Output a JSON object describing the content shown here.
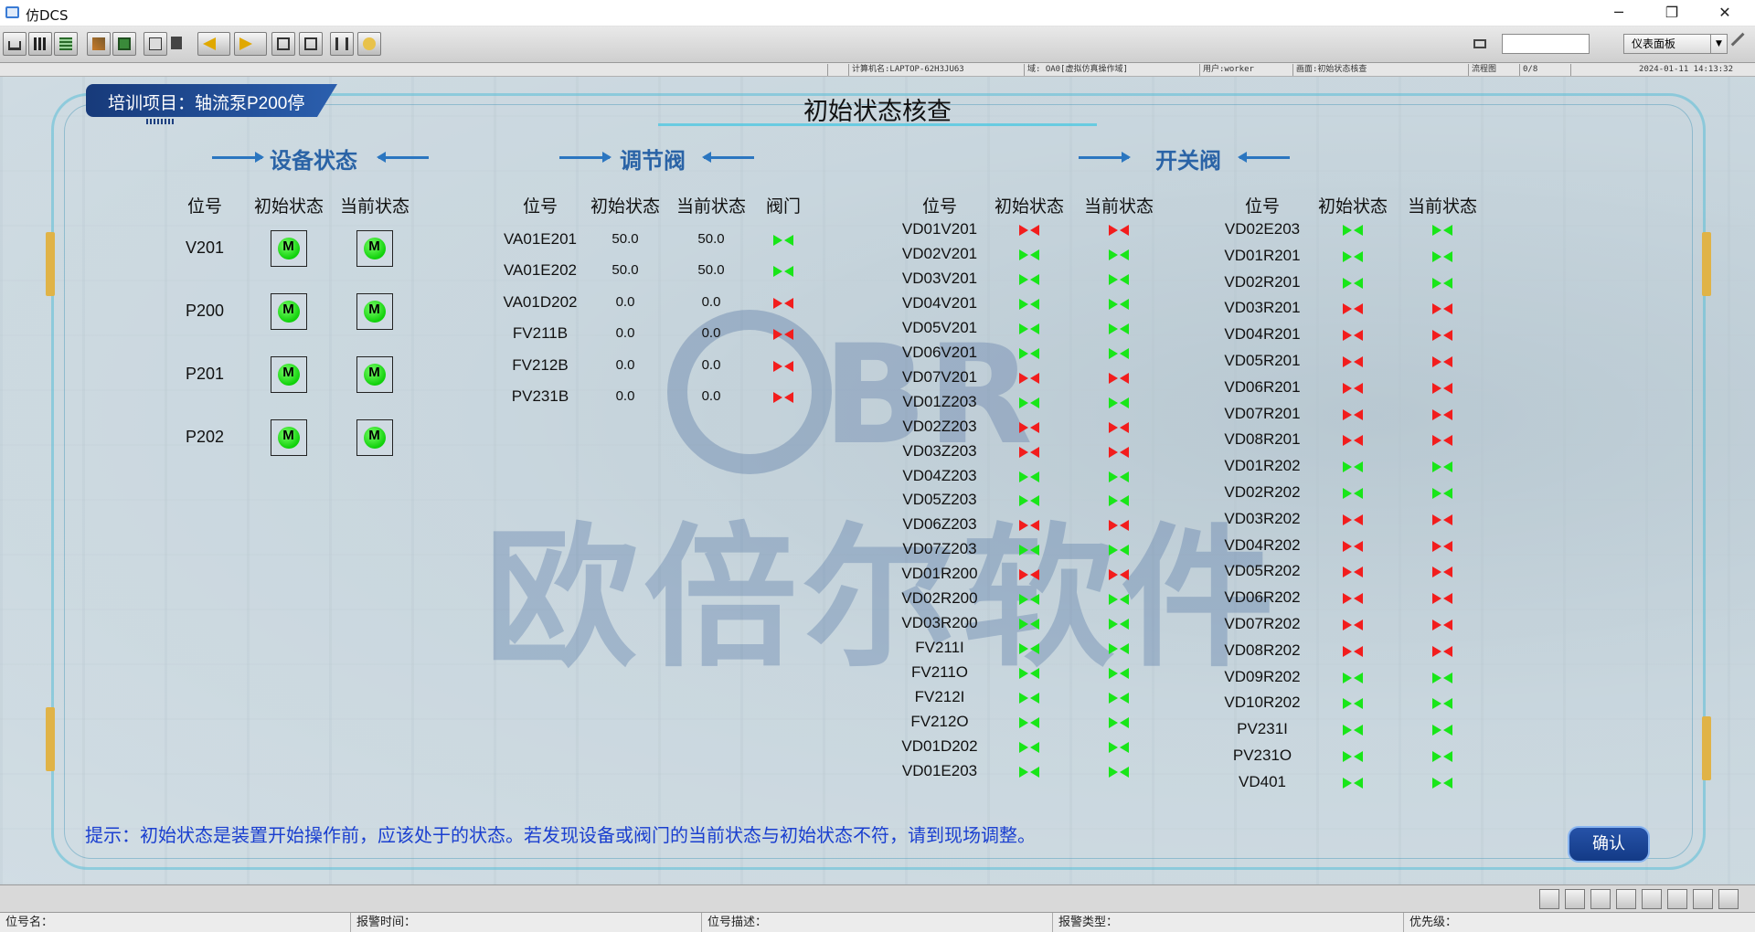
{
  "window": {
    "title": "仿DCS",
    "minimize": "─",
    "maximize": "❐",
    "close": "✕"
  },
  "toolbar": {
    "panel_select": "仪表面板",
    "search_value": ""
  },
  "infobar": {
    "computer": "计算机名:LAPTOP-62H3JU63",
    "domain": "域: OA0[虚拟仿真操作域]",
    "user": "用户:worker",
    "screen": "画面:初始状态核查",
    "mode": "流程图",
    "page": "0/8",
    "datetime": "2024-01-11 14:13:32"
  },
  "header": {
    "project": "培训项目：轴流泵P200停",
    "title": "初始状态核查"
  },
  "watermark": {
    "brand": "BR",
    "company": "欧倍尔软件"
  },
  "equipment": {
    "title": "设备状态",
    "headers": [
      "位号",
      "初始状态",
      "当前状态"
    ],
    "rows": [
      {
        "tag": "V201",
        "initial": "M",
        "current": "M"
      },
      {
        "tag": "P200",
        "initial": "M",
        "current": "M"
      },
      {
        "tag": "P201",
        "initial": "M",
        "current": "M"
      },
      {
        "tag": "P202",
        "initial": "M",
        "current": "M"
      }
    ]
  },
  "control_valves": {
    "title": "调节阀",
    "headers": [
      "位号",
      "初始状态",
      "当前状态",
      "阀门"
    ],
    "rows": [
      {
        "tag": "VA01E201",
        "initial": "50.0",
        "current": "50.0",
        "valve": "open"
      },
      {
        "tag": "VA01E202",
        "initial": "50.0",
        "current": "50.0",
        "valve": "open"
      },
      {
        "tag": "VA01D202",
        "initial": "0.0",
        "current": "0.0",
        "valve": "closed"
      },
      {
        "tag": "FV211B",
        "initial": "0.0",
        "current": "0.0",
        "valve": "closed"
      },
      {
        "tag": "FV212B",
        "initial": "0.0",
        "current": "0.0",
        "valve": "closed"
      },
      {
        "tag": "PV231B",
        "initial": "0.0",
        "current": "0.0",
        "valve": "closed"
      }
    ]
  },
  "switch_valves": {
    "title": "开关阀",
    "headers": [
      "位号",
      "初始状态",
      "当前状态"
    ],
    "left": [
      {
        "tag": "VD01V201",
        "initial": "closed",
        "current": "closed"
      },
      {
        "tag": "VD02V201",
        "initial": "open",
        "current": "open"
      },
      {
        "tag": "VD03V201",
        "initial": "open",
        "current": "open"
      },
      {
        "tag": "VD04V201",
        "initial": "open",
        "current": "open"
      },
      {
        "tag": "VD05V201",
        "initial": "open",
        "current": "open"
      },
      {
        "tag": "VD06V201",
        "initial": "open",
        "current": "open"
      },
      {
        "tag": "VD07V201",
        "initial": "closed",
        "current": "closed"
      },
      {
        "tag": "VD01Z203",
        "initial": "open",
        "current": "open"
      },
      {
        "tag": "VD02Z203",
        "initial": "closed",
        "current": "closed"
      },
      {
        "tag": "VD03Z203",
        "initial": "closed",
        "current": "closed"
      },
      {
        "tag": "VD04Z203",
        "initial": "open",
        "current": "open"
      },
      {
        "tag": "VD05Z203",
        "initial": "open",
        "current": "open"
      },
      {
        "tag": "VD06Z203",
        "initial": "closed",
        "current": "closed"
      },
      {
        "tag": "VD07Z203",
        "initial": "open",
        "current": "open"
      },
      {
        "tag": "VD01R200",
        "initial": "closed",
        "current": "closed"
      },
      {
        "tag": "VD02R200",
        "initial": "open",
        "current": "open"
      },
      {
        "tag": "VD03R200",
        "initial": "open",
        "current": "open"
      },
      {
        "tag": "FV211I",
        "initial": "open",
        "current": "open"
      },
      {
        "tag": "FV211O",
        "initial": "open",
        "current": "open"
      },
      {
        "tag": "FV212I",
        "initial": "open",
        "current": "open"
      },
      {
        "tag": "FV212O",
        "initial": "open",
        "current": "open"
      },
      {
        "tag": "VD01D202",
        "initial": "open",
        "current": "open"
      },
      {
        "tag": "VD01E203",
        "initial": "open",
        "current": "open"
      }
    ],
    "right": [
      {
        "tag": "VD02E203",
        "initial": "open",
        "current": "open"
      },
      {
        "tag": "VD01R201",
        "initial": "open",
        "current": "open"
      },
      {
        "tag": "VD02R201",
        "initial": "open",
        "current": "open"
      },
      {
        "tag": "VD03R201",
        "initial": "closed",
        "current": "closed"
      },
      {
        "tag": "VD04R201",
        "initial": "closed",
        "current": "closed"
      },
      {
        "tag": "VD05R201",
        "initial": "closed",
        "current": "closed"
      },
      {
        "tag": "VD06R201",
        "initial": "closed",
        "current": "closed"
      },
      {
        "tag": "VD07R201",
        "initial": "closed",
        "current": "closed"
      },
      {
        "tag": "VD08R201",
        "initial": "closed",
        "current": "closed"
      },
      {
        "tag": "VD01R202",
        "initial": "open",
        "current": "open"
      },
      {
        "tag": "VD02R202",
        "initial": "open",
        "current": "open"
      },
      {
        "tag": "VD03R202",
        "initial": "closed",
        "current": "closed"
      },
      {
        "tag": "VD04R202",
        "initial": "closed",
        "current": "closed"
      },
      {
        "tag": "VD05R202",
        "initial": "closed",
        "current": "closed"
      },
      {
        "tag": "VD06R202",
        "initial": "closed",
        "current": "closed"
      },
      {
        "tag": "VD07R202",
        "initial": "closed",
        "current": "closed"
      },
      {
        "tag": "VD08R202",
        "initial": "closed",
        "current": "closed"
      },
      {
        "tag": "VD09R202",
        "initial": "open",
        "current": "open"
      },
      {
        "tag": "VD10R202",
        "initial": "open",
        "current": "open"
      },
      {
        "tag": "PV231I",
        "initial": "open",
        "current": "open"
      },
      {
        "tag": "PV231O",
        "initial": "open",
        "current": "open"
      },
      {
        "tag": "VD401",
        "initial": "open",
        "current": "open"
      }
    ]
  },
  "colors": {
    "open": "#19e619",
    "closed": "#f21d1d",
    "accent": "#2a63a6"
  },
  "hint": "提示：初始状态是装置开始操作前，应该处于的状态。若发现设备或阀门的当前状态与初始状态不符，请到现场调整。",
  "confirm_label": "确认",
  "statusbar": {
    "tag_name": "位号名：",
    "alarm_time": "报警时间：",
    "tag_desc": "位号描述：",
    "alarm_type": "报警类型：",
    "priority": "优先级："
  }
}
